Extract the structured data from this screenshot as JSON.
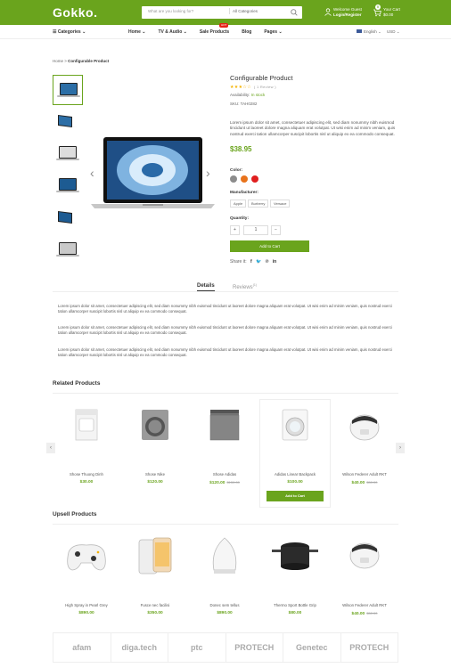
{
  "colors": {
    "accent": "#6aa41d",
    "hot": "#e62117"
  },
  "header": {
    "logo": "Gokko.",
    "search_placeholder": "What are you looking for?",
    "search_category": "All Categories",
    "welcome": "Welcome Guest",
    "login": "Login/Register",
    "cart_count": "0",
    "cart_label": "Your Cart",
    "cart_total": "$0.00"
  },
  "nav": {
    "categories": "Categories",
    "items": [
      "Home",
      "TV & Audio",
      "Sale Products",
      "Blog",
      "Pages"
    ],
    "hot_badge": "HOT",
    "language": "English",
    "currency": "USD"
  },
  "breadcrumb": {
    "home": "Home",
    "current": "Configurable Product"
  },
  "product": {
    "title": "Configurable Product",
    "rating_stars": "★★★☆☆",
    "reviews": "( 1 Review )",
    "availability_label": "Availability:",
    "availability": "In stock",
    "sku": "SKU: TAH0282",
    "description": "Lorem ipsum dolor sit amet, consectetuer adipiscing elit, sed diam nonummy nibh euismod tincidunt ut laoreet dolore magna aliquam erat volutpat. Ut wisi enim ad minim veniam, quis nostrud exerci tation ullamcorper suscipit lobortis nisl ut aliquip ex ea commodo consequat.",
    "price": "$38.95",
    "color_label": "Color:",
    "colors": [
      "#8c8c8c",
      "#e8731c",
      "#e01f1f"
    ],
    "manufacturer_label": "Manufacturer:",
    "manufacturers": [
      "Apple",
      "Burberry",
      "Versace"
    ],
    "quantity_label": "Quantity:",
    "qty_minus": "+",
    "qty_value": "1",
    "qty_plus": "−",
    "add_to_cart": "Add to Cart",
    "share_label": "Share it:",
    "share_icons": [
      "f",
      "🐦",
      "℗",
      "in"
    ]
  },
  "tabs": {
    "details": "Details",
    "reviews": "Reviews",
    "reviews_count": "(1)"
  },
  "details_paragraphs": [
    "Lorem ipsum dolor sit amet, consectetuer adipiscing elit, sed diam nonummy nibh euismod tincidunt ut laoreet dolore magna aliquam erat volutpat. Ut wisi enim ad minim veniam, quis nostrud exerci tation ullamcorper suscipit lobortis nisl ut aliquip ex ea commodo consequat.",
    "Lorem ipsum dolor sit amet, consectetuer adipiscing elit, sed diam nonummy nibh euismod tincidunt ut laoreet dolore magna aliquam erat volutpat. Ut wisi enim ad minim veniam, quis nostrud exerci tation ullamcorper suscipit lobortis nisl ut aliquip ex ea commodo consequat.",
    "Lorem ipsum dolor sit amet, consectetuer adipiscing elit, sed diam nonummy nibh euismod tincidunt ut laoreet dolore magna aliquam erat volutpat. Ut wisi enim ad minim veniam, quis nostrud exerci tation ullamcorper suscipit lobortis nisl ut aliquip ex ea commodo consequat."
  ],
  "related": {
    "title": "Related Products",
    "add_to_cart": "Add to Cart",
    "items": [
      {
        "name": "Shose Thuong Dinh",
        "price": "$30.00",
        "old": ""
      },
      {
        "name": "Shose Nike",
        "price": "$120.00",
        "old": ""
      },
      {
        "name": "Shose Adidas",
        "price": "$120.00",
        "old": "$150.00"
      },
      {
        "name": "Adidas Linear Backpack",
        "price": "$100.00",
        "old": ""
      },
      {
        "name": "Wilson Federer Adult RKT",
        "price": "$40.00",
        "old": "$50.00"
      }
    ]
  },
  "upsell": {
    "title": "Upsell Products",
    "items": [
      {
        "name": "High Spray in Pearl Grey",
        "price": "$890.00",
        "old": ""
      },
      {
        "name": "Fusce nec facilisi",
        "price": "$350.00",
        "old": ""
      },
      {
        "name": "Donec sem tellus",
        "price": "$890.00",
        "old": ""
      },
      {
        "name": "Thermo Sport Bottle Grip",
        "price": "$80.00",
        "old": ""
      },
      {
        "name": "Wilson Federer Adult RKT",
        "price": "$40.00",
        "old": "$50.00"
      }
    ]
  },
  "brands": [
    "afam",
    "diga.tech",
    "ptc",
    "PROTECH",
    "Genetec",
    "PROTECH"
  ]
}
